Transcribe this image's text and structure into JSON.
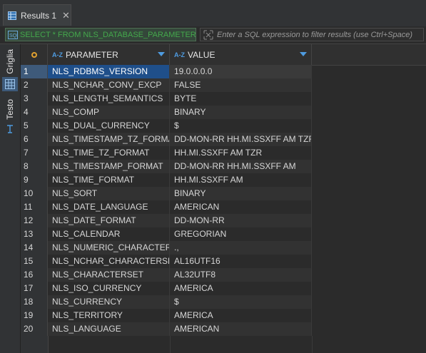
{
  "tab": {
    "label": "Results 1",
    "close": "✕"
  },
  "filter": {
    "sql": "SELECT * FROM NLS_DATABASE_PARAMETERS",
    "placeholder": "Enter a SQL expression to filter results (use Ctrl+Space)"
  },
  "side": {
    "grid_label": "Griglia",
    "text_label": "Testo"
  },
  "columns": {
    "param": "PARAMETER",
    "value": "VALUE"
  },
  "rows": [
    {
      "n": "1",
      "param": "NLS_RDBMS_VERSION",
      "value": "19.0.0.0.0"
    },
    {
      "n": "2",
      "param": "NLS_NCHAR_CONV_EXCP",
      "value": "FALSE"
    },
    {
      "n": "3",
      "param": "NLS_LENGTH_SEMANTICS",
      "value": "BYTE"
    },
    {
      "n": "4",
      "param": "NLS_COMP",
      "value": "BINARY"
    },
    {
      "n": "5",
      "param": "NLS_DUAL_CURRENCY",
      "value": "$"
    },
    {
      "n": "6",
      "param": "NLS_TIMESTAMP_TZ_FORMAT",
      "value": "DD-MON-RR HH.MI.SSXFF AM TZR"
    },
    {
      "n": "7",
      "param": "NLS_TIME_TZ_FORMAT",
      "value": "HH.MI.SSXFF AM TZR"
    },
    {
      "n": "8",
      "param": "NLS_TIMESTAMP_FORMAT",
      "value": "DD-MON-RR HH.MI.SSXFF AM"
    },
    {
      "n": "9",
      "param": "NLS_TIME_FORMAT",
      "value": "HH.MI.SSXFF AM"
    },
    {
      "n": "10",
      "param": "NLS_SORT",
      "value": "BINARY"
    },
    {
      "n": "11",
      "param": "NLS_DATE_LANGUAGE",
      "value": "AMERICAN"
    },
    {
      "n": "12",
      "param": "NLS_DATE_FORMAT",
      "value": "DD-MON-RR"
    },
    {
      "n": "13",
      "param": "NLS_CALENDAR",
      "value": "GREGORIAN"
    },
    {
      "n": "14",
      "param": "NLS_NUMERIC_CHARACTERS",
      "value": ".,"
    },
    {
      "n": "15",
      "param": "NLS_NCHAR_CHARACTERSET",
      "value": "AL16UTF16"
    },
    {
      "n": "16",
      "param": "NLS_CHARACTERSET",
      "value": "AL32UTF8"
    },
    {
      "n": "17",
      "param": "NLS_ISO_CURRENCY",
      "value": "AMERICA"
    },
    {
      "n": "18",
      "param": "NLS_CURRENCY",
      "value": "$"
    },
    {
      "n": "19",
      "param": "NLS_TERRITORY",
      "value": "AMERICA"
    },
    {
      "n": "20",
      "param": "NLS_LANGUAGE",
      "value": "AMERICAN"
    }
  ],
  "icons": {
    "tab": "grid-icon",
    "sql": "sql-icon",
    "filter": "filter-icon",
    "corner": "circle-icon",
    "text_panel": "text-icon"
  },
  "colors": {
    "selected_row": "#1f4f8a",
    "sql_text": "#44a84c",
    "accent": "#4e9be0"
  }
}
